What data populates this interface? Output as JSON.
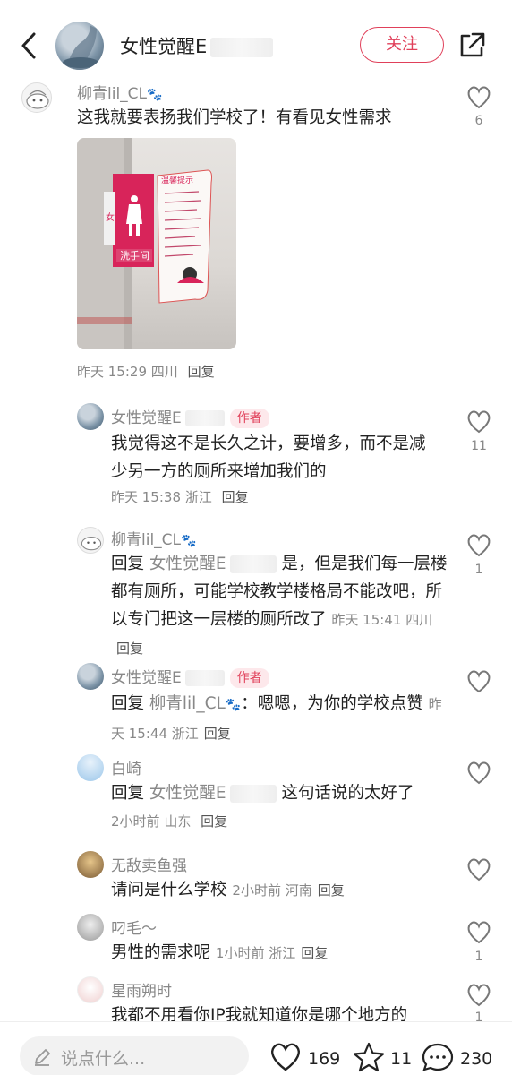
{
  "header": {
    "name": "女性觉醒E",
    "follow_label": "关注"
  },
  "comments": [
    {
      "user": "柳青lil_CL",
      "text": "这我就要表扬我们学校了！有看见女性需求",
      "photo": {
        "sign_left": "女",
        "sign_label": "洗手间",
        "board_title": "温馨提示"
      },
      "time": "昨天 15:29",
      "location": "四川",
      "reply_label": "回复",
      "likes": "6"
    },
    {
      "user": "女性觉醒E",
      "tag": "作者",
      "text": "我觉得这不是长久之计，要增多，而不是减少另一方的厕所来增加我们的",
      "time": "昨天 15:38",
      "location": "浙江",
      "reply_label": "回复",
      "likes": "11"
    },
    {
      "user": "柳青lil_CL",
      "reply_prefix": "回复",
      "reply_to": "女性觉醒E",
      "text": "是，但是我们每一层楼都有厕所，可能学校教学楼格局不能改吧，所以专门把这一层楼的厕所改了",
      "time": "昨天 15:41",
      "location": "四川",
      "reply_label": "回复",
      "likes": "1"
    },
    {
      "user": "女性觉醒E",
      "tag": "作者",
      "reply_prefix": "回复",
      "reply_to": "柳青lil_CL",
      "text": "：嗯嗯，为你的学校点赞",
      "time": "昨天 15:44",
      "location": "浙江",
      "reply_label": "回复"
    },
    {
      "user": "白崎",
      "reply_prefix": "回复",
      "reply_to": "女性觉醒E",
      "text": "这句话说的太好了",
      "time": "2小时前",
      "location": "山东",
      "reply_label": "回复"
    },
    {
      "user": "无敌卖鱼强",
      "text": "请问是什么学校",
      "time": "2小时前",
      "location": "河南",
      "reply_label": "回复"
    },
    {
      "user": "叼毛～",
      "text": "男性的需求呢",
      "time": "1小时前",
      "location": "浙江",
      "reply_label": "回复",
      "likes": "1"
    },
    {
      "user": "星雨朔时",
      "text": "我都不用看你IP我就知道你是哪个地方的",
      "likes": "1"
    }
  ],
  "bottom_bar": {
    "input_placeholder": "说点什么...",
    "likes": "169",
    "stars": "11",
    "comments": "230"
  },
  "colors": {
    "accent": "#e0405a",
    "muted": "#888888",
    "input_bg": "#f2f2f2"
  }
}
